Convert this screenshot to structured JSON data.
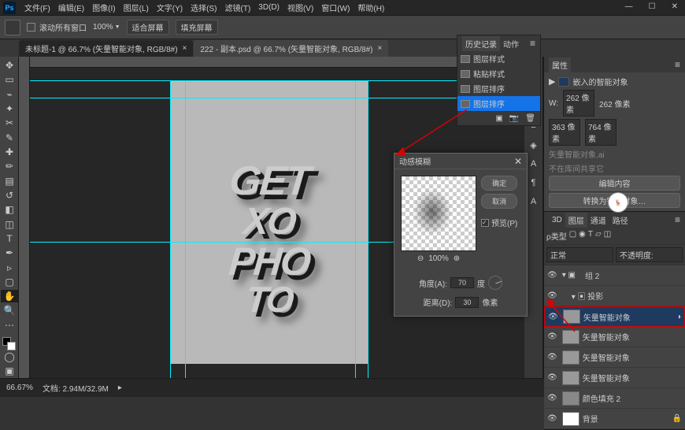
{
  "menu": {
    "file": "文件(F)",
    "edit": "编辑(E)",
    "image": "图像(I)",
    "layer": "图层(L)",
    "type": "文字(Y)",
    "select": "选择(S)",
    "filter": "滤镜(T)",
    "td": "3D(D)",
    "view": "视图(V)",
    "window": "窗口(W)",
    "help": "帮助(H)"
  },
  "opt": {
    "scroll": "滚动所有窗口",
    "pct": "100%",
    "fit": "适合屏幕",
    "fill": "填充屏幕"
  },
  "tabs": {
    "t1": "未标题-1 @ 66.7% (矢量智能对象, RGB/8#)",
    "t2": "222 - 副本.psd @ 66.7% (矢量智能对象, RGB/8#)"
  },
  "history": {
    "title": "历史记录",
    "actions": "动作",
    "i1": "图层样式",
    "i2": "粘贴样式",
    "i3": "图层排序",
    "i4": "图层排序"
  },
  "props": {
    "title": "属性",
    "type": "嵌入的智能对象",
    "w": "W:",
    "wval": "262 像素",
    "h": "262 像素",
    "xval": "363 像素",
    "yval": "764 像素",
    "so": "矢量智能对象.ai",
    "note": "不在库间共享它",
    "edit": "编辑内容",
    "convert": "转换为链接对象…"
  },
  "layersPanel": {
    "t1": "3D",
    "t2": "图层",
    "t3": "通道",
    "t4": "路径",
    "kind": "正常",
    "opacity": "不透明度:",
    "grp": "组 2",
    "shad": "投影",
    "so": "矢量智能对象",
    "fill": "颜色填充 2",
    "bg": "背景"
  },
  "dialog": {
    "title": "动感模糊",
    "ok": "确定",
    "cancel": "取消",
    "preview": "预览(P)",
    "zoom": "100%",
    "angle": "角度(A):",
    "angleVal": "70",
    "deg": "度",
    "dist": "距离(D):",
    "distVal": "30",
    "px": "像素"
  },
  "status": {
    "zoom": "66.67%",
    "doc": "文档: 2.94M/32.9M"
  },
  "canvasText": {
    "l1": "GET",
    "l2": "XO",
    "l3": "PHO",
    "l4": "TO"
  }
}
